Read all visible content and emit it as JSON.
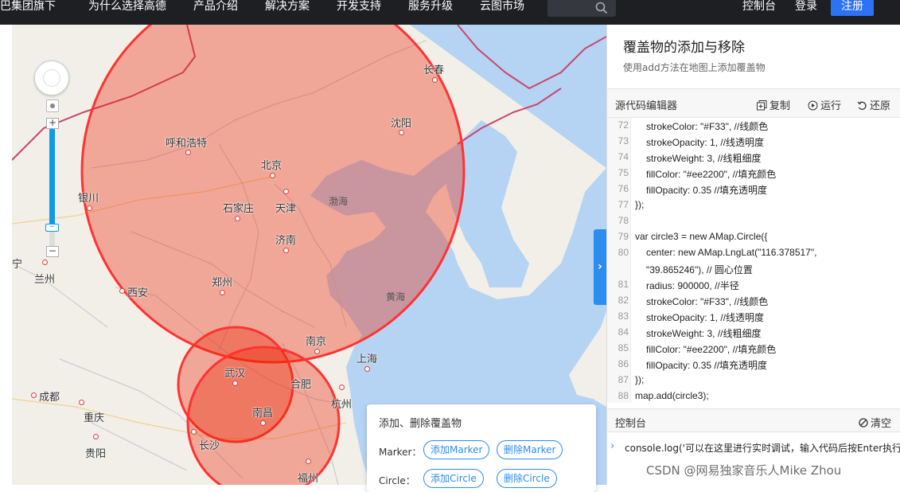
{
  "nav": {
    "items": [
      "巴集团旗下",
      "为什么选择高德",
      "产品介绍",
      "解决方案",
      "开发支持",
      "服务升级",
      "云图市场"
    ],
    "console": "控制台",
    "login": "登录",
    "register": "注册"
  },
  "map": {
    "cities": [
      "长春",
      "沈阳",
      "呼和浩特",
      "北京",
      "银川",
      "石家庄",
      "天津",
      "济南",
      "兰州",
      "西安",
      "郑州",
      "南京",
      "上海",
      "武汉",
      "合肥",
      "成都",
      "重庆",
      "杭州",
      "南昌",
      "长沙",
      "贵阳",
      "福州"
    ],
    "seas": [
      "渤海",
      "黄海"
    ],
    "partial_label": "宁"
  },
  "overlay_card": {
    "title": "添加、删除覆盖物",
    "marker_label": "Marker：",
    "add_marker": "添加Marker",
    "remove_marker": "删除Marker",
    "circle_label": "Circle：",
    "add_circle": "添加Circle",
    "remove_circle": "删除Circle"
  },
  "panel": {
    "title": "覆盖物的添加与移除",
    "subtitle": "使用add方法在地图上添加覆盖物",
    "editor_label": "源代码编辑器",
    "copy": "复制",
    "run": "运行",
    "reset": "还原",
    "code_lines": [
      {
        "n": "72",
        "text": "strokeColor: \"#F33\",  //线颜色"
      },
      {
        "n": "73",
        "text": "strokeOpacity: 1,  //线透明度"
      },
      {
        "n": "74",
        "text": "strokeWeight: 3,  //线粗细度"
      },
      {
        "n": "75",
        "text": "fillColor: \"#ee2200\",  //填充颜色"
      },
      {
        "n": "76",
        "text": "fillOpacity: 0.35 //填充透明度"
      },
      {
        "n": "77",
        "text": "});"
      },
      {
        "n": "78",
        "text": ""
      },
      {
        "n": "79",
        "text": "var circle3 = new AMap.Circle({"
      },
      {
        "n": "80",
        "text": "center: new AMap.LngLat(\"116.378517\","
      },
      {
        "n": "",
        "text": "\"39.865246\"), // 圆心位置"
      },
      {
        "n": "81",
        "text": "radius: 900000,  //半径"
      },
      {
        "n": "82",
        "text": "strokeColor: \"#F33\",  //线颜色"
      },
      {
        "n": "83",
        "text": "strokeOpacity: 1,  //线透明度"
      },
      {
        "n": "84",
        "text": "strokeWeight: 3,  //线粗细度"
      },
      {
        "n": "85",
        "text": "fillColor: \"#ee2200\",  //填充颜色"
      },
      {
        "n": "86",
        "text": "fillOpacity: 0.35 //填充透明度"
      },
      {
        "n": "87",
        "text": "});"
      },
      {
        "n": "88",
        "text": "map.add(circle3);"
      }
    ],
    "console_label": "控制台",
    "clear": "清空",
    "console_command": "console.log('可以在这里进行实时调试，输入代码后按Enter执行')"
  },
  "watermark": "CSDN @网易独家音乐人Mike Zhou",
  "colors": {
    "nav_bg": "#1d1f23",
    "register_bg": "#2d72f6",
    "circle_stroke": "#FF3333",
    "circle_fill": "#ee2200",
    "button_accent": "#2d8cf0"
  }
}
